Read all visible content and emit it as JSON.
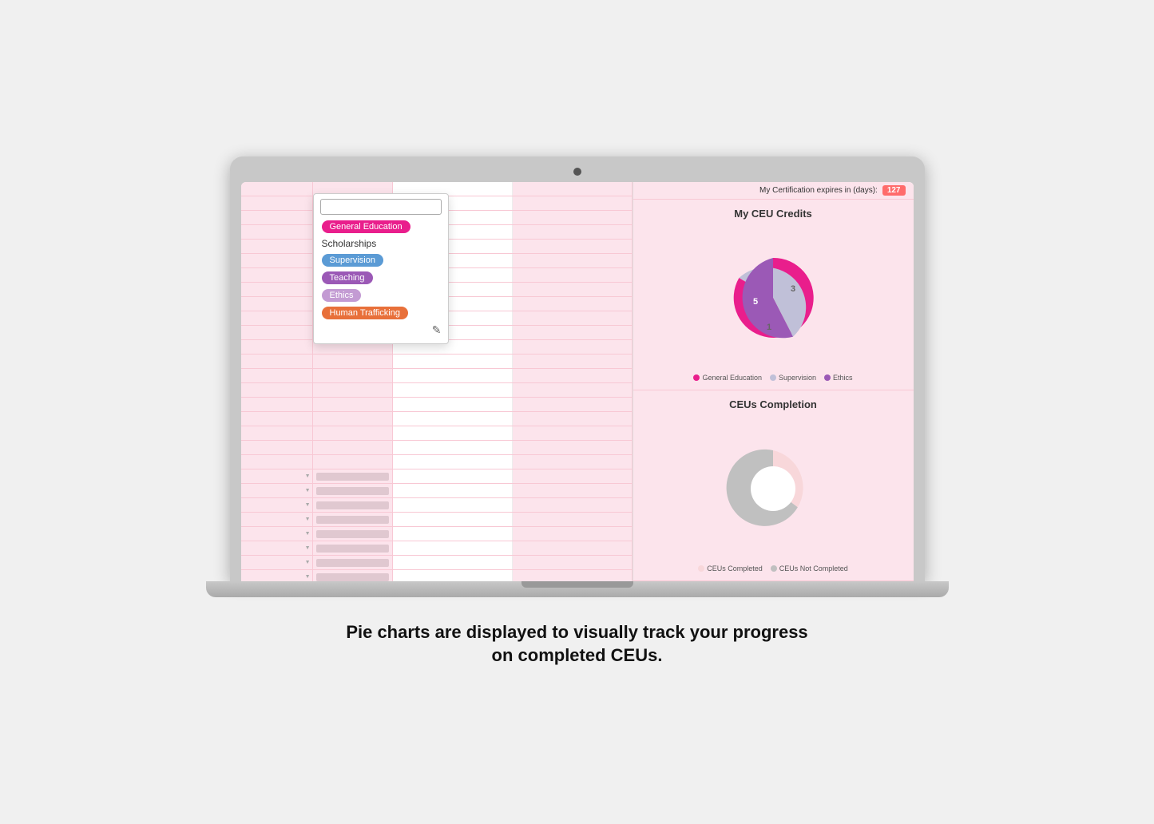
{
  "laptop": {
    "cert_notice_text": "My Certification expires in (days):",
    "cert_days": "127"
  },
  "dropdown": {
    "search_placeholder": "",
    "items": [
      {
        "id": "general-education",
        "label": "General Education",
        "tag": true,
        "tag_class": "tag-pink"
      },
      {
        "id": "scholarships",
        "label": "Scholarships",
        "tag": false
      },
      {
        "id": "supervision",
        "label": "Supervision",
        "tag": true,
        "tag_class": "tag-blue"
      },
      {
        "id": "teaching",
        "label": "Teaching",
        "tag": true,
        "tag_class": "tag-purple"
      },
      {
        "id": "ethics",
        "label": "Ethics",
        "tag": true,
        "tag_class": "tag-light-purple"
      },
      {
        "id": "human-trafficking",
        "label": "Human Trafficking",
        "tag": true,
        "tag_class": "tag-orange"
      }
    ]
  },
  "chart_ceu": {
    "title": "My CEU Credits",
    "segments": [
      {
        "label": "General Education",
        "value": 5,
        "color": "#e91e8c",
        "legend_color": "#e91e8c"
      },
      {
        "label": "Supervision",
        "value": 3,
        "color": "#c0c0d8",
        "legend_color": "#c0c0d8"
      },
      {
        "label": "Ethics",
        "value": 1,
        "color": "#9b59b6",
        "legend_color": "#9b59b6"
      }
    ]
  },
  "chart_completion": {
    "title": "CEUs Completion",
    "legend": [
      {
        "label": "CEUs Completed",
        "color": "#f8d7da"
      },
      {
        "label": "CEUs Not Completed",
        "color": "#c0c0c0"
      }
    ]
  },
  "caption": {
    "line1": "Pie charts are displayed to visually track your progress",
    "line2": "on completed CEUs."
  }
}
